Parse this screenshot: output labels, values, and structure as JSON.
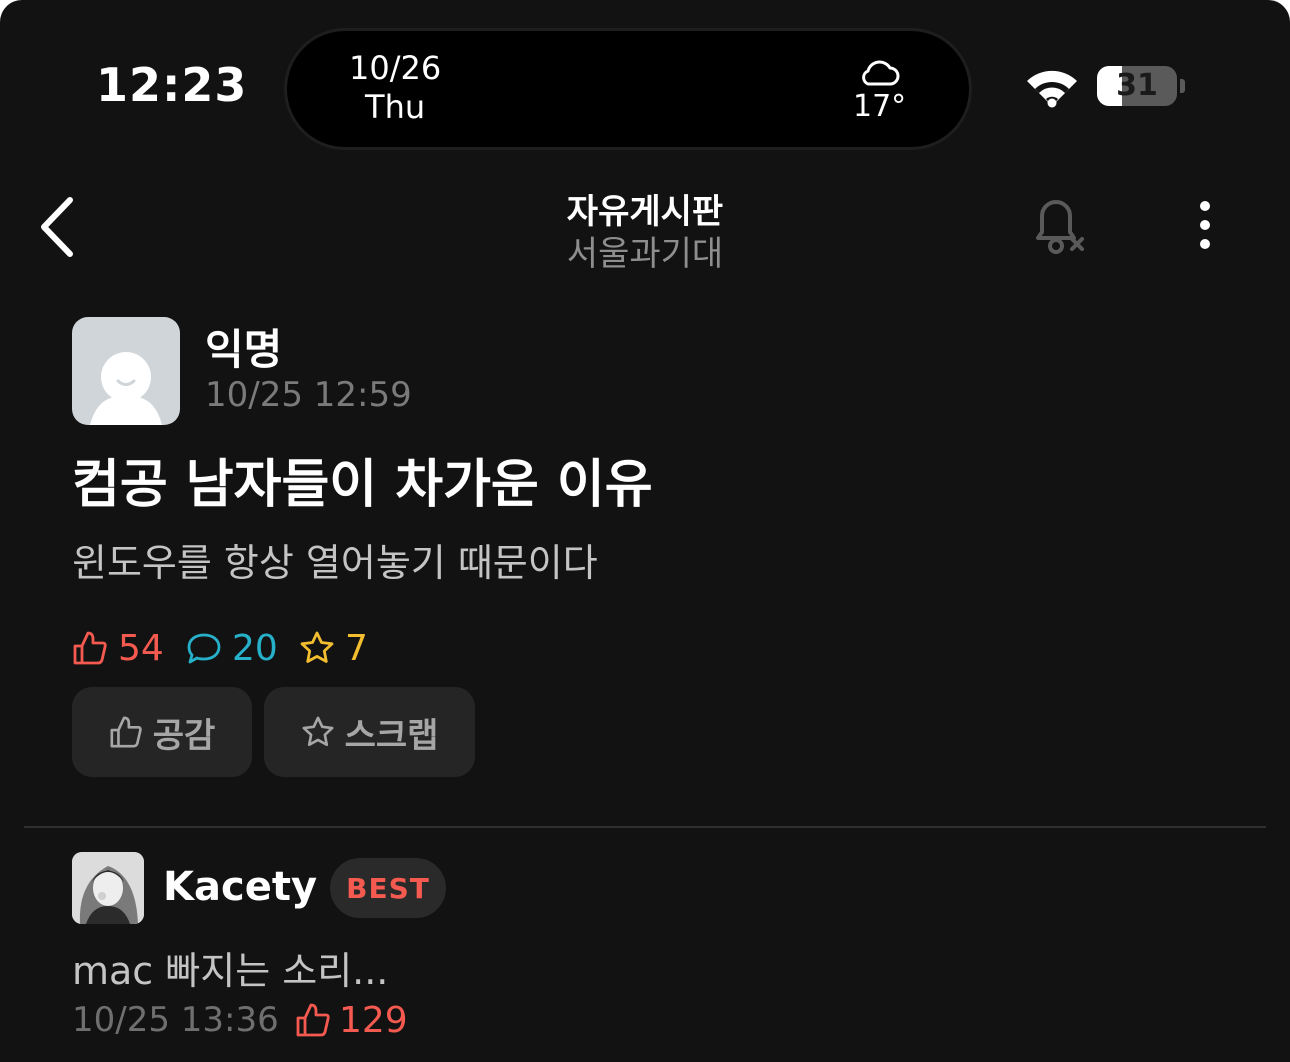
{
  "status_bar": {
    "time": "12:23",
    "island": {
      "date": "10/26",
      "weekday": "Thu",
      "temperature": "17°",
      "weather_icon": "cloud-icon"
    },
    "wifi_icon": "wifi-icon",
    "battery_level": "31",
    "battery_fraction": 0.31
  },
  "header": {
    "back_icon": "chevron-left-icon",
    "title": "자유게시판",
    "subtitle": "서울과기대",
    "notification_icon": "bell-off-icon",
    "more_icon": "more-vertical-icon"
  },
  "post": {
    "author": "익명",
    "date": "10/25 12:59",
    "title": "컴공 남자들이 차가운 이유",
    "body": "윈도우를 항상 열어놓기 때문이다",
    "stats": {
      "likes": "54",
      "comments": "20",
      "scraps": "7"
    },
    "buttons": {
      "like_label": "공감",
      "scrap_label": "스크랩"
    }
  },
  "comment": {
    "author": "Kacety",
    "badge": "BEST",
    "text": "mac 빠지는 소리...",
    "date": "10/25 13:36",
    "likes": "129"
  },
  "colors": {
    "background": "#121212",
    "like": "#f45a4f",
    "comment": "#27b0c9",
    "scrap": "#f2bd2e",
    "button_bg": "#252525"
  }
}
